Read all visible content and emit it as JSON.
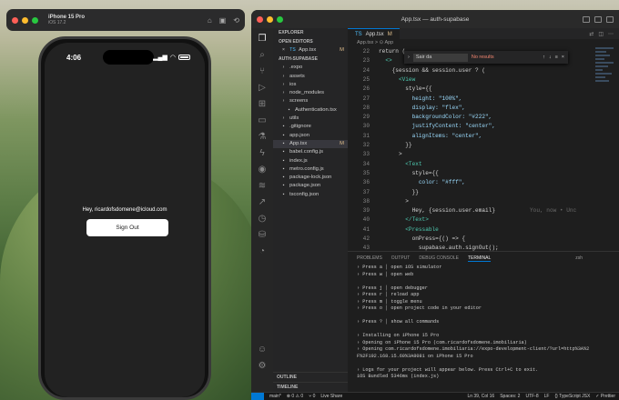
{
  "simulator": {
    "title": "iPhone 15 Pro",
    "subtitle": "iOS 17.2"
  },
  "phone": {
    "time": "4:06",
    "hey_text": "Hey, ricardofsdomene@icloud.com",
    "signout_label": "Sign Out"
  },
  "vscode": {
    "title": "App.tsx — auth-supabase"
  },
  "sidebar": {
    "explorer": "EXPLORER",
    "open_editors": "OPEN EDITORS",
    "open_file": "App.tsx",
    "open_file_mod": "M",
    "project": "AUTH-SUPABASE",
    "items": [
      {
        "label": ".expo"
      },
      {
        "label": "assets"
      },
      {
        "label": "ios"
      },
      {
        "label": "node_modules"
      },
      {
        "label": "screens"
      },
      {
        "label": "Authentication.tsx"
      },
      {
        "label": "utils"
      },
      {
        "label": ".gitignore"
      },
      {
        "label": "app.json"
      },
      {
        "label": "App.tsx",
        "mod": "M"
      },
      {
        "label": "babel.config.js"
      },
      {
        "label": "index.js"
      },
      {
        "label": "metro.config.js"
      },
      {
        "label": "package-lock.json"
      },
      {
        "label": "package.json"
      },
      {
        "label": "tsconfig.json"
      }
    ],
    "outline": "OUTLINE",
    "timeline": "TIMELINE"
  },
  "editor": {
    "tab": "App.tsx",
    "tab_mod": "M",
    "breadcrumb": "App.tsx > ⊙ App",
    "find": {
      "value": "Sair da",
      "result": "No results"
    },
    "lines": [
      {
        "n": "22",
        "t": "return ("
      },
      {
        "n": "23",
        "t": "  <>"
      },
      {
        "n": "24",
        "t": "    {session && session.user ? ("
      },
      {
        "n": "25",
        "t": "      <View"
      },
      {
        "n": "26",
        "t": "        style={{"
      },
      {
        "n": "27",
        "t": "          height: \"100%\","
      },
      {
        "n": "28",
        "t": "          display: \"flex\","
      },
      {
        "n": "29",
        "t": "          backgroundColor: \"#222\","
      },
      {
        "n": "30",
        "t": "          justifyContent: \"center\","
      },
      {
        "n": "31",
        "t": "          alignItems: \"center\","
      },
      {
        "n": "32",
        "t": "        }}"
      },
      {
        "n": "33",
        "t": "      >"
      },
      {
        "n": "34",
        "t": "        <Text"
      },
      {
        "n": "35",
        "t": "          style={{"
      },
      {
        "n": "36",
        "t": "            color: \"#fff\","
      },
      {
        "n": "37",
        "t": "          }}"
      },
      {
        "n": "38",
        "t": "        >"
      },
      {
        "n": "39",
        "t": "          Hey, {session.user.email}"
      },
      {
        "n": "40",
        "t": "        </Text>"
      },
      {
        "n": "41",
        "t": "        <Pressable"
      },
      {
        "n": "42",
        "t": "          onPress={() => {"
      },
      {
        "n": "43",
        "t": "            supabase.auth.signOut();"
      }
    ],
    "inline_hint": "You, now • Unc"
  },
  "panel": {
    "tabs": [
      "PROBLEMS",
      "OUTPUT",
      "DEBUG CONSOLE",
      "TERMINAL"
    ],
    "active": "TERMINAL",
    "shell": "zsh",
    "lines": [
      "› Press a │ open iOS simulator",
      "› Press w │ open web",
      "",
      "› Press j │ open debugger",
      "› Press r │ reload app",
      "› Press m │ toggle menu",
      "› Press o │ open project code in your editor",
      "",
      "› Press ? │ show all commands",
      "",
      "› Installing on iPhone 15 Pro",
      "› Opening on iPhone 15 Pro (com.ricardofsdomene.imobiliaria)",
      "› Opening com.ricardofsdomene.imobiliaria://expo-development-client/?url=http%3A%2",
      "F%2F192.168.15.60%3A8081 on iPhone 15 Pro",
      "",
      "› Logs for your project will appear below. Press Ctrl+C to exit.",
      "iOS Bundled 5346ms (index.js)"
    ]
  },
  "statusbar": {
    "branch": "main*",
    "problems": "⊗ 0 ⚠ 0",
    "ports": "⑂ 0",
    "live": "Live Share",
    "pos": "Ln 39, Col 16",
    "spaces": "Spaces: 2",
    "enc": "UTF-8",
    "eol": "LF",
    "lang": "{} TypeScript JSX",
    "prettier": "✓ Prettier"
  }
}
